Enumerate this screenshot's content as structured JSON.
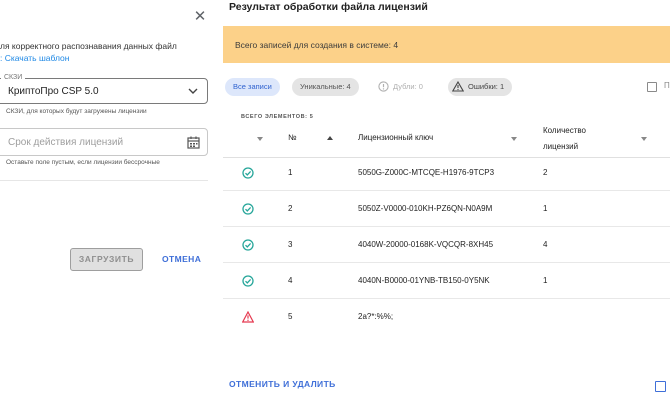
{
  "dialog": {
    "close_icon": "close-icon",
    "instruction_text": "ля корректного распознавания данных файл",
    "template_link": ": Скачать шаблон",
    "skzi": {
      "legend": "СКЗИ",
      "value": "КриптоПро CSP 5.0",
      "helper": "СКЗИ, для которых будут загружены лицензии"
    },
    "validity": {
      "placeholder": "Срок действия лицензий",
      "helper": "Оставьте поле пустым, если лицензии бессрочные"
    },
    "upload_label": "ЗАГРУЗИТЬ",
    "cancel_label": "ОТМЕНА"
  },
  "result": {
    "title": "Результат обработки файла лицензий",
    "banner_text": "Всего записей для создания в системе: 4",
    "filters": {
      "all": "Все записи",
      "unique": "Уникальные: 4",
      "duplicates": "Дубли: 0",
      "errors": "Ошибки: 1"
    },
    "right_checkbox_label": "П",
    "total_label": "ВСЕГО ЭЛЕМЕНТОВ: 5",
    "columns": {
      "number": "№",
      "key": "Лицензионный ключ",
      "qty_line1": "Количество",
      "qty_line2": "лицензий"
    },
    "rows": [
      {
        "status": "ok",
        "num": "1",
        "key": "5050G-Z000C-MTCQE-H1976-9TCP3",
        "qty": "2"
      },
      {
        "status": "ok",
        "num": "2",
        "key": "5050Z-V0000-010KH-PZ6QN-N0A9M",
        "qty": "1"
      },
      {
        "status": "ok",
        "num": "3",
        "key": "4040W-20000-0168K-VQCQR-8XH45",
        "qty": "4"
      },
      {
        "status": "ok",
        "num": "4",
        "key": "4040N-B0000-01YNB-TB150-0Y5NK",
        "qty": "1"
      },
      {
        "status": "error",
        "num": "5",
        "key": "2a?*:%%;",
        "qty": ""
      }
    ],
    "bottom_action": "ОТМЕНИТЬ И УДАЛИТЬ"
  },
  "colors": {
    "accent": "#3f6fd8",
    "success": "#26a69a",
    "error": "#e53950",
    "banner": "#fcd189"
  }
}
